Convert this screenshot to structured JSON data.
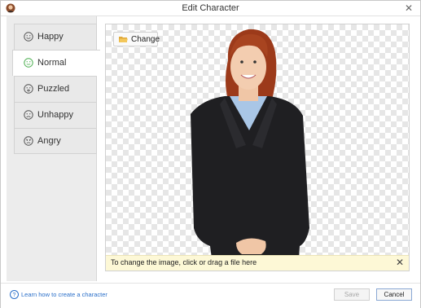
{
  "window": {
    "title": "Edit Character",
    "close_icon": "close-icon",
    "app_icon": "character-avatar-icon"
  },
  "moods": [
    {
      "label": "Happy",
      "icon": "happy-face-icon",
      "selected": false
    },
    {
      "label": "Normal",
      "icon": "normal-face-icon",
      "selected": true
    },
    {
      "label": "Puzzled",
      "icon": "puzzled-face-icon",
      "selected": false
    },
    {
      "label": "Unhappy",
      "icon": "unhappy-face-icon",
      "selected": false
    },
    {
      "label": "Angry",
      "icon": "angry-face-icon",
      "selected": false
    }
  ],
  "canvas": {
    "change_label": "Change",
    "change_icon": "folder-open-icon",
    "hint_text": "To change the image, click or drag a file here",
    "hint_close": "✕"
  },
  "footer": {
    "help_text": "Learn how to create a character",
    "help_icon": "question-circle-icon",
    "save_label": "Save",
    "cancel_label": "Cancel"
  },
  "colors": {
    "accent_selected_face": "#4caf50",
    "link": "#2a6fc9",
    "hint_bg": "#fdf8d6"
  }
}
